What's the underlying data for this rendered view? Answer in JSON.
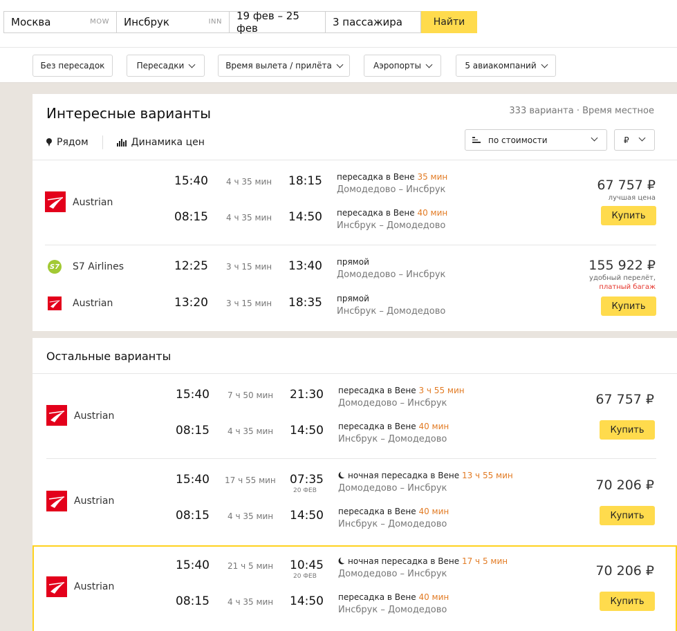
{
  "search": {
    "from": {
      "value": "Москва",
      "code": "MOW"
    },
    "to": {
      "value": "Инсбрук",
      "code": "INN"
    },
    "dates": "19 фев – 25 фев",
    "passengers": "3 пассажира",
    "find_label": "Найти"
  },
  "filters": [
    "Без пересадок",
    "Пересадки",
    "Время вылета / прилёта",
    "Аэропорты",
    "5 авиакомпаний"
  ],
  "interesting": {
    "title": "Интересные варианты",
    "meta": "333 варианта · Время местное",
    "nearby": "Рядом",
    "dynamics": "Динамика цен",
    "sort_label": "по стоимости",
    "currency": "₽",
    "offers": [
      {
        "price": "67 757 ₽",
        "notes": [
          "лучшая цена"
        ],
        "buy": "Купить",
        "legs": [
          {
            "airline": "Austrian",
            "dep": "15:40",
            "dur": "4 ч 35 мин",
            "arr": "18:15",
            "arr_note": "",
            "stop_text": "пересадка в Вене",
            "stop_time": "35 мин",
            "route": "Домодедово – Инсбрук"
          },
          {
            "airline": "",
            "dep": "08:15",
            "dur": "4 ч 35 мин",
            "arr": "14:50",
            "arr_note": "",
            "stop_text": "пересадка в Вене",
            "stop_time": "40 мин",
            "route": "Инсбрук – Домодедово"
          }
        ]
      },
      {
        "price": "155 922 ₽",
        "notes": [
          "удобный перелёт,",
          "платный багаж"
        ],
        "buy": "Купить",
        "legs": [
          {
            "airline": "S7 Airlines",
            "dep": "12:25",
            "dur": "3 ч 15 мин",
            "arr": "13:40",
            "arr_note": "",
            "stop_text": "прямой",
            "stop_time": "",
            "route": "Домодедово – Инсбрук"
          },
          {
            "airline": "Austrian",
            "dep": "13:20",
            "dur": "3 ч 15 мин",
            "arr": "18:35",
            "arr_note": "",
            "stop_text": "прямой",
            "stop_time": "",
            "route": "Инсбрук – Домодедово"
          }
        ]
      }
    ]
  },
  "others": {
    "title": "Остальные варианты",
    "offers": [
      {
        "price": "67 757 ₽",
        "buy": "Купить",
        "airline": "Austrian",
        "legs": [
          {
            "dep": "15:40",
            "dur": "7 ч 50 мин",
            "arr": "21:30",
            "arr_note": "",
            "night": false,
            "stop_text": "пересадка в Вене",
            "stop_time": "3 ч 55 мин",
            "route": "Домодедово – Инсбрук"
          },
          {
            "dep": "08:15",
            "dur": "4 ч 35 мин",
            "arr": "14:50",
            "arr_note": "",
            "night": false,
            "stop_text": "пересадка в Вене",
            "stop_time": "40 мин",
            "route": "Инсбрук – Домодедово"
          }
        ]
      },
      {
        "price": "70 206 ₽",
        "buy": "Купить",
        "airline": "Austrian",
        "legs": [
          {
            "dep": "15:40",
            "dur": "17 ч 55 мин",
            "arr": "07:35",
            "arr_note": "20 ФЕВ",
            "night": true,
            "stop_text": "ночная пересадка в Вене",
            "stop_time": "13 ч 55 мин",
            "route": "Домодедово – Инсбрук"
          },
          {
            "dep": "08:15",
            "dur": "4 ч 35 мин",
            "arr": "14:50",
            "arr_note": "",
            "night": false,
            "stop_text": "пересадка в Вене",
            "stop_time": "40 мин",
            "route": "Инсбрук – Домодедово"
          }
        ]
      },
      {
        "price": "70 206 ₽",
        "buy": "Купить",
        "airline": "Austrian",
        "legs": [
          {
            "dep": "15:40",
            "dur": "21 ч 5 мин",
            "arr": "10:45",
            "arr_note": "20 ФЕВ",
            "night": true,
            "stop_text": "ночная пересадка в Вене",
            "stop_time": "17 ч 5 мин",
            "route": "Домодедово – Инсбрук"
          },
          {
            "dep": "08:15",
            "dur": "4 ч 35 мин",
            "arr": "14:50",
            "arr_note": "",
            "night": false,
            "stop_text": "пересадка в Вене",
            "stop_time": "40 мин",
            "route": "Инсбрук – Домодедово"
          }
        ]
      }
    ]
  },
  "colors": {
    "accent_yellow": "#ffdb4d",
    "transfer_orange": "#e27b24",
    "warning_red": "#e5332a",
    "austrian_red": "#e3001b",
    "s7_green": "#a2c934"
  },
  "icons": {
    "nearby": "map-pin-icon",
    "dynamics": "bar-chart-icon",
    "sort": "sort-lines-icon",
    "night": "moon-icon"
  }
}
